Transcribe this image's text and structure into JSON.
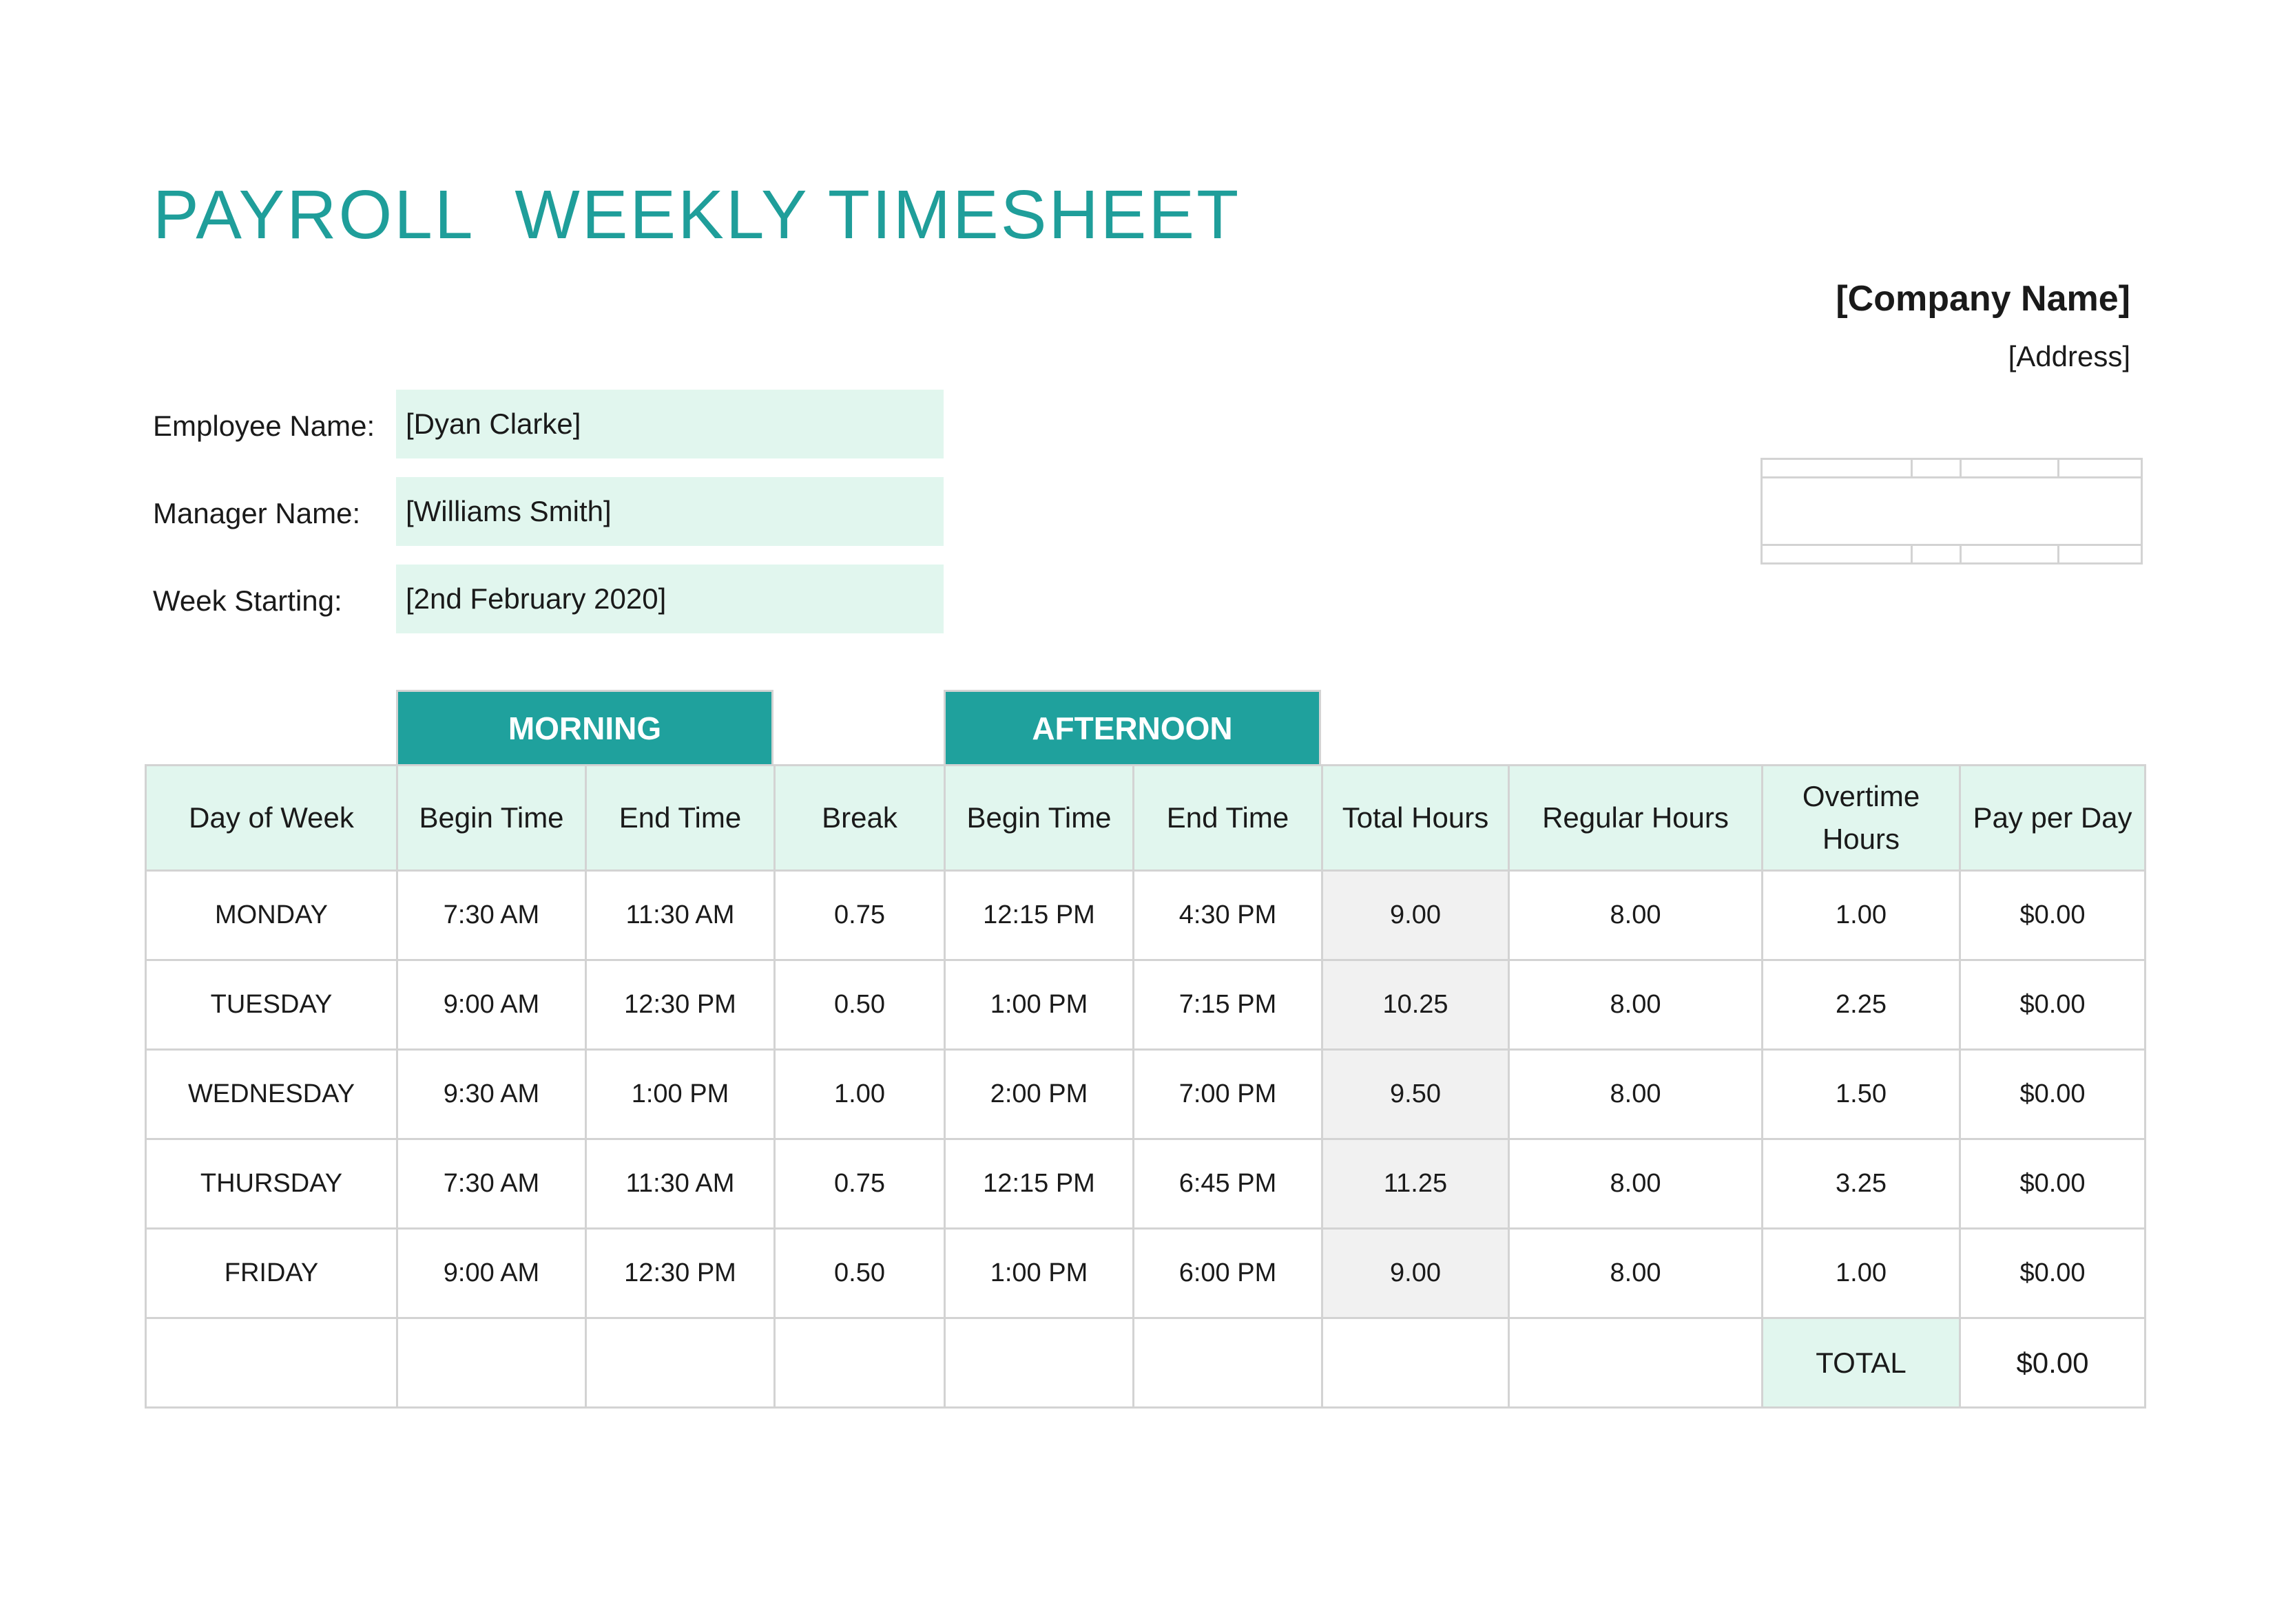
{
  "title": "PAYROLL  WEEKLY TIMESHEET",
  "company": {
    "name": "[Company Name]",
    "address": "[Address]"
  },
  "info": {
    "employee_label": "Employee Name:",
    "employee_value": "[Dyan Clarke]",
    "manager_label": "Manager Name:",
    "manager_value": "[Williams Smith]",
    "week_label": "Week Starting:",
    "week_value": "[2nd February 2020]"
  },
  "sections": {
    "morning": "MORNING",
    "afternoon": "AFTERNOON"
  },
  "columns": {
    "day": "Day of Week",
    "am_begin": "Begin Time",
    "am_end": "End Time",
    "break": "Break",
    "pm_begin": "Begin Time",
    "pm_end": "End Time",
    "total_hours": "Total Hours",
    "regular_hours": "Regular Hours",
    "overtime_line1": "Overtime",
    "overtime_line2": "Hours",
    "pay_per_day": "Pay per Day"
  },
  "rows": [
    {
      "day": "MONDAY",
      "am_begin": "7:30 AM",
      "am_end": "11:30 AM",
      "break": "0.75",
      "pm_begin": "12:15 PM",
      "pm_end": "4:30 PM",
      "total": "9.00",
      "regular": "8.00",
      "overtime": "1.00",
      "pay": "$0.00"
    },
    {
      "day": "TUESDAY",
      "am_begin": "9:00 AM",
      "am_end": "12:30 PM",
      "break": "0.50",
      "pm_begin": "1:00 PM",
      "pm_end": "7:15 PM",
      "total": "10.25",
      "regular": "8.00",
      "overtime": "2.25",
      "pay": "$0.00"
    },
    {
      "day": "WEDNESDAY",
      "am_begin": "9:30 AM",
      "am_end": "1:00 PM",
      "break": "1.00",
      "pm_begin": "2:00 PM",
      "pm_end": "7:00 PM",
      "total": "9.50",
      "regular": "8.00",
      "overtime": "1.50",
      "pay": "$0.00"
    },
    {
      "day": "THURSDAY",
      "am_begin": "7:30 AM",
      "am_end": "11:30 AM",
      "break": "0.75",
      "pm_begin": "12:15 PM",
      "pm_end": "6:45 PM",
      "total": "11.25",
      "regular": "8.00",
      "overtime": "3.25",
      "pay": "$0.00"
    },
    {
      "day": "FRIDAY",
      "am_begin": "9:00 AM",
      "am_end": "12:30 PM",
      "break": "0.50",
      "pm_begin": "1:00 PM",
      "pm_end": "6:00 PM",
      "total": "9.00",
      "regular": "8.00",
      "overtime": "1.00",
      "pay": "$0.00"
    }
  ],
  "totals": {
    "label": "TOTAL",
    "value": "$0.00"
  },
  "colors": {
    "accent": "#1fa19d",
    "title": "#1f9e9a",
    "light_fill": "#e1f6ee",
    "grey_fill": "#f1f1f1",
    "grid": "#d3d3d3"
  }
}
